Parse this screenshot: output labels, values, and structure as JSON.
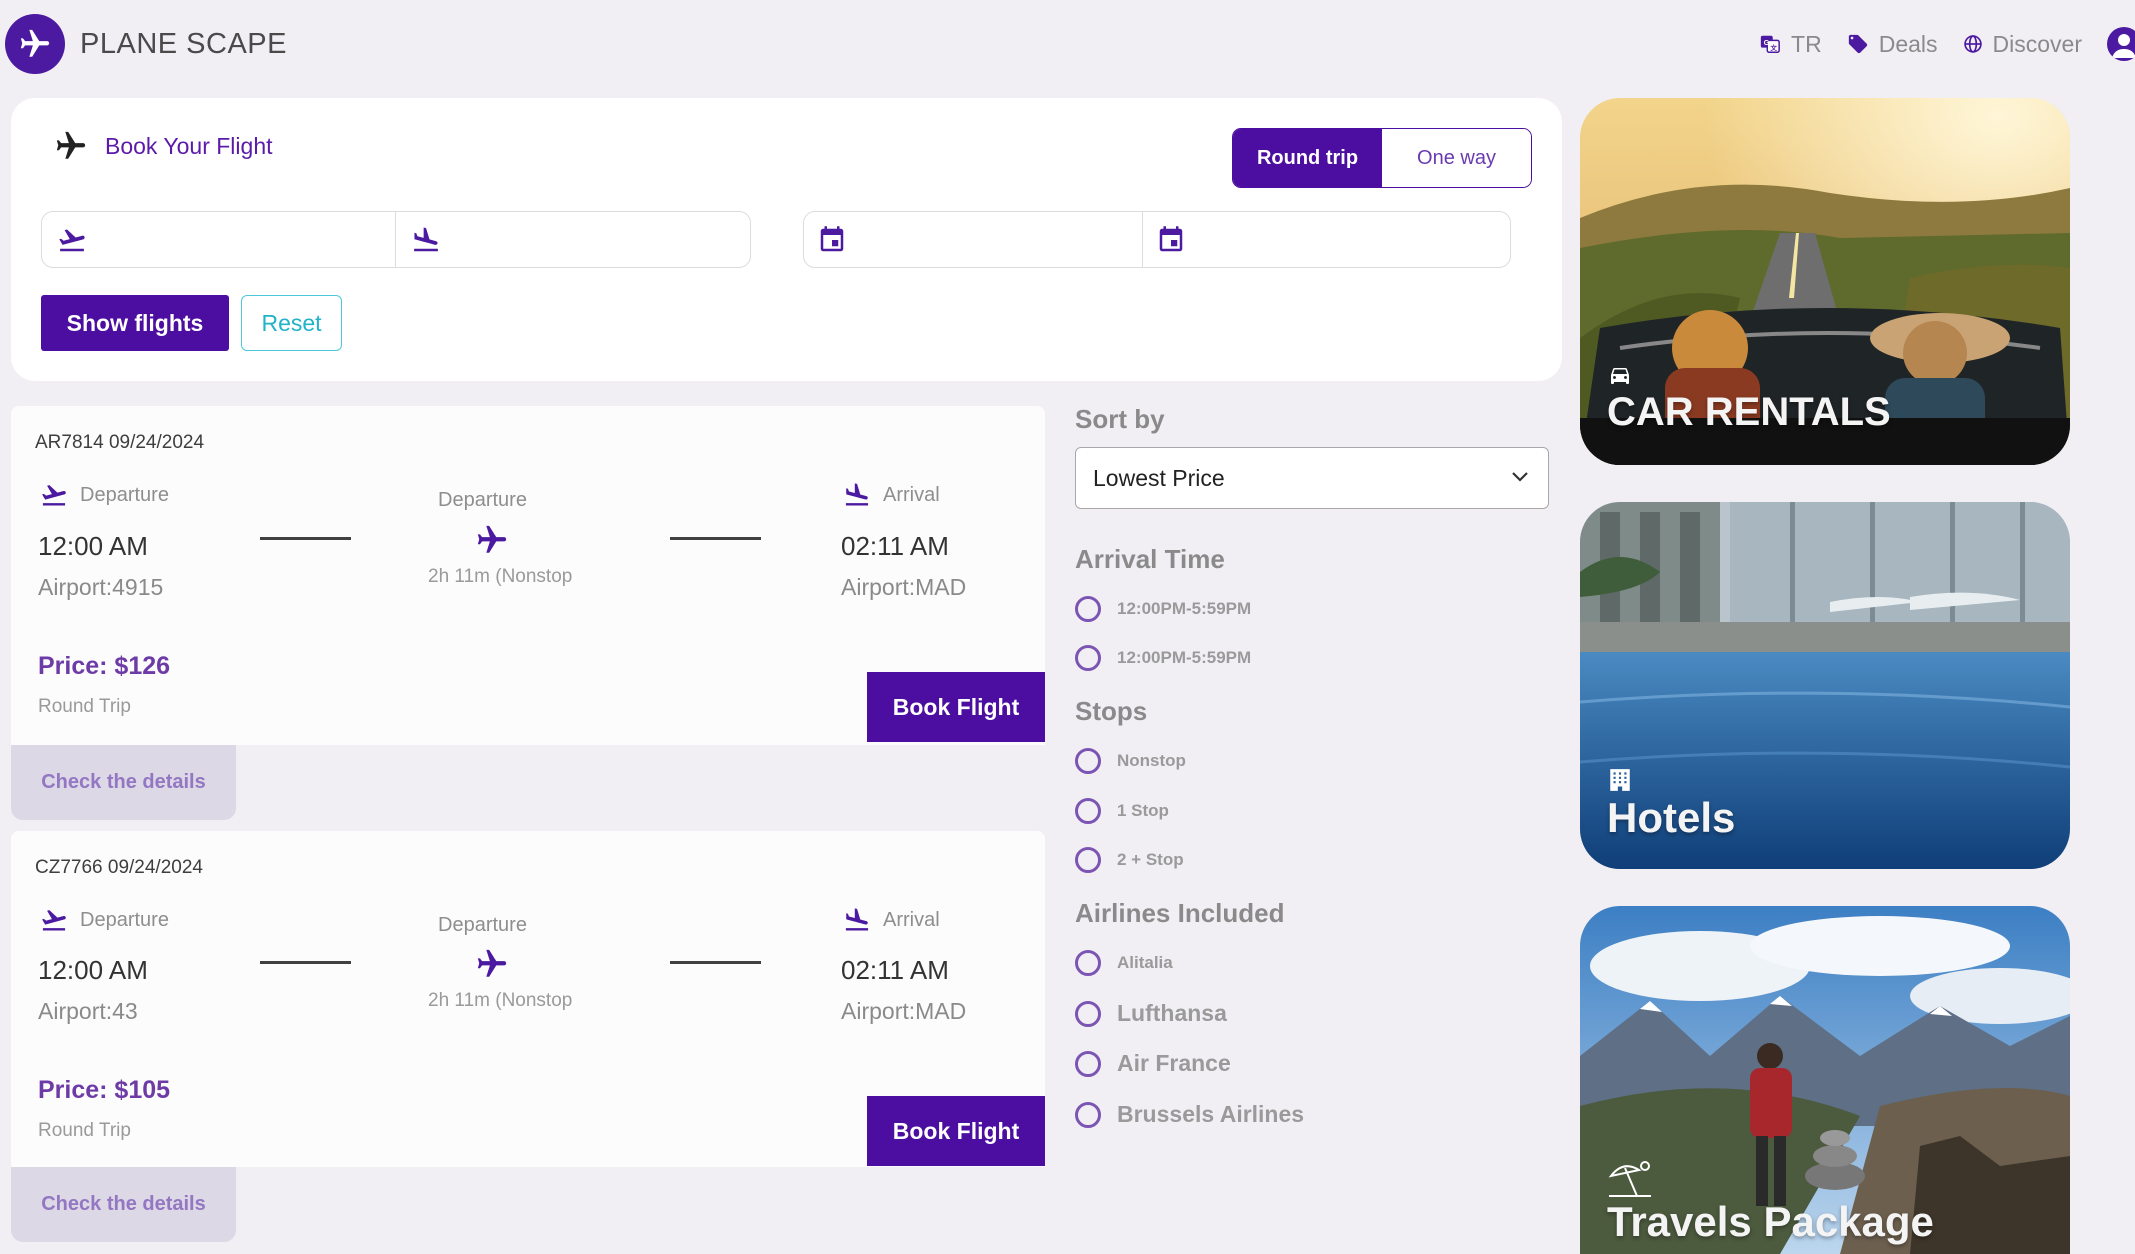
{
  "header": {
    "brand": "PLANE SCAPE",
    "nav": {
      "language": "TR",
      "deals": "Deals",
      "discover": "Discover"
    }
  },
  "booking": {
    "title": "Book Your Flight",
    "trip_toggle": {
      "round_trip": "Round trip",
      "one_way": "One way",
      "selected": "Round trip"
    },
    "fields": {
      "from": "",
      "to": "",
      "depart_date": "",
      "return_date": ""
    },
    "show_flights": "Show flights",
    "reset": "Reset"
  },
  "flights": [
    {
      "code": "AR7814 09/24/2024",
      "departure_label": "Departure",
      "departure_time": "12:00 AM",
      "departure_airport": "Airport:4915",
      "middle_label": "Departure",
      "duration": "2h 11m (Nonstop",
      "arrival_label": "Arrival",
      "arrival_time": "02:11 AM",
      "arrival_airport": "Airport:MAD",
      "price": "Price: $126",
      "trip_type": "Round Trip",
      "book": "Book Flight",
      "details": "Check the details"
    },
    {
      "code": "CZ7766 09/24/2024",
      "departure_label": "Departure",
      "departure_time": "12:00 AM",
      "departure_airport": "Airport:43",
      "middle_label": "Departure",
      "duration": "2h 11m (Nonstop",
      "arrival_label": "Arrival",
      "arrival_time": "02:11 AM",
      "arrival_airport": "Airport:MAD",
      "price": "Price: $105",
      "trip_type": "Round Trip",
      "book": "Book Flight",
      "details": "Check the details"
    }
  ],
  "filters": {
    "sort_by": {
      "heading": "Sort by",
      "selected": "Lowest Price"
    },
    "arrival_time": {
      "heading": "Arrival Time",
      "options": [
        "12:00PM-5:59PM",
        "12:00PM-5:59PM"
      ]
    },
    "stops": {
      "heading": "Stops",
      "options": [
        "Nonstop",
        "1 Stop",
        "2 + Stop"
      ]
    },
    "airlines": {
      "heading": "Airlines Included",
      "options": [
        "Alitalia",
        "Lufthansa",
        "Air France",
        "Brussels Airlines"
      ]
    }
  },
  "promos": {
    "car_rentals": "CAR RENTALS",
    "hotels": "Hotels",
    "travels_package": "Travels Package"
  },
  "colors": {
    "brand_purple": "#4b0ea0",
    "accent_cyan": "#21b3c8",
    "background": "#f1eff4"
  },
  "icons": {
    "logo": "airplane-icon",
    "language": "translate-icon",
    "deals": "tag-icon",
    "discover": "globe-icon",
    "account": "user-icon",
    "takeoff": "takeoff-icon",
    "landing": "landing-icon",
    "calendar": "calendar-icon"
  }
}
